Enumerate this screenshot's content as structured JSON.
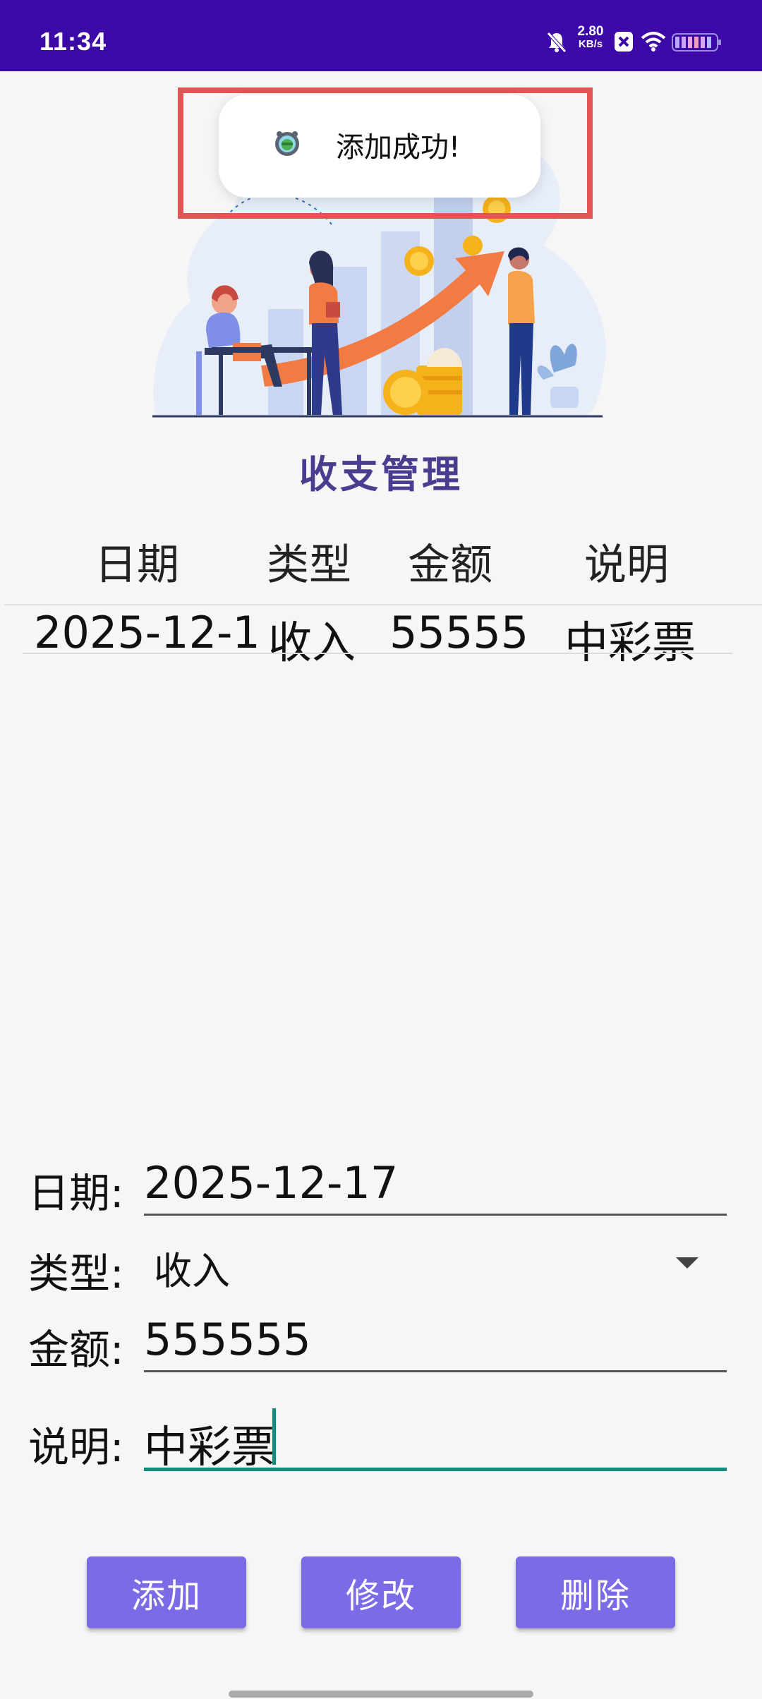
{
  "status_bar": {
    "time": "11:34",
    "net_speed_value": "2.80",
    "net_speed_unit": "KB/s",
    "icons": [
      "mute-bell-icon",
      "close-box-icon",
      "wifi-icon",
      "battery-icon"
    ]
  },
  "toast": {
    "message": "添加成功!",
    "icon": "app-icon"
  },
  "header": {
    "title": "收支管理"
  },
  "table": {
    "columns": [
      "日期",
      "类型",
      "金额",
      "说明"
    ],
    "rows": [
      [
        "2025-12-1",
        "收入",
        "55555",
        "中彩票"
      ]
    ]
  },
  "form": {
    "date": {
      "label": "日期:",
      "value": "2025-12-17"
    },
    "type": {
      "label": "类型:",
      "value": "收入"
    },
    "amount": {
      "label": "金额:",
      "value": "555555"
    },
    "note": {
      "label": "说明:",
      "value": "中彩票"
    }
  },
  "buttons": {
    "add": "添加",
    "edit": "修改",
    "delete": "删除"
  },
  "colors": {
    "status_bar": "#3c08a8",
    "button": "#7b6be6",
    "title": "#4a3d8f",
    "toast_frame": "#e25555",
    "focus_accent": "#138a7c"
  }
}
